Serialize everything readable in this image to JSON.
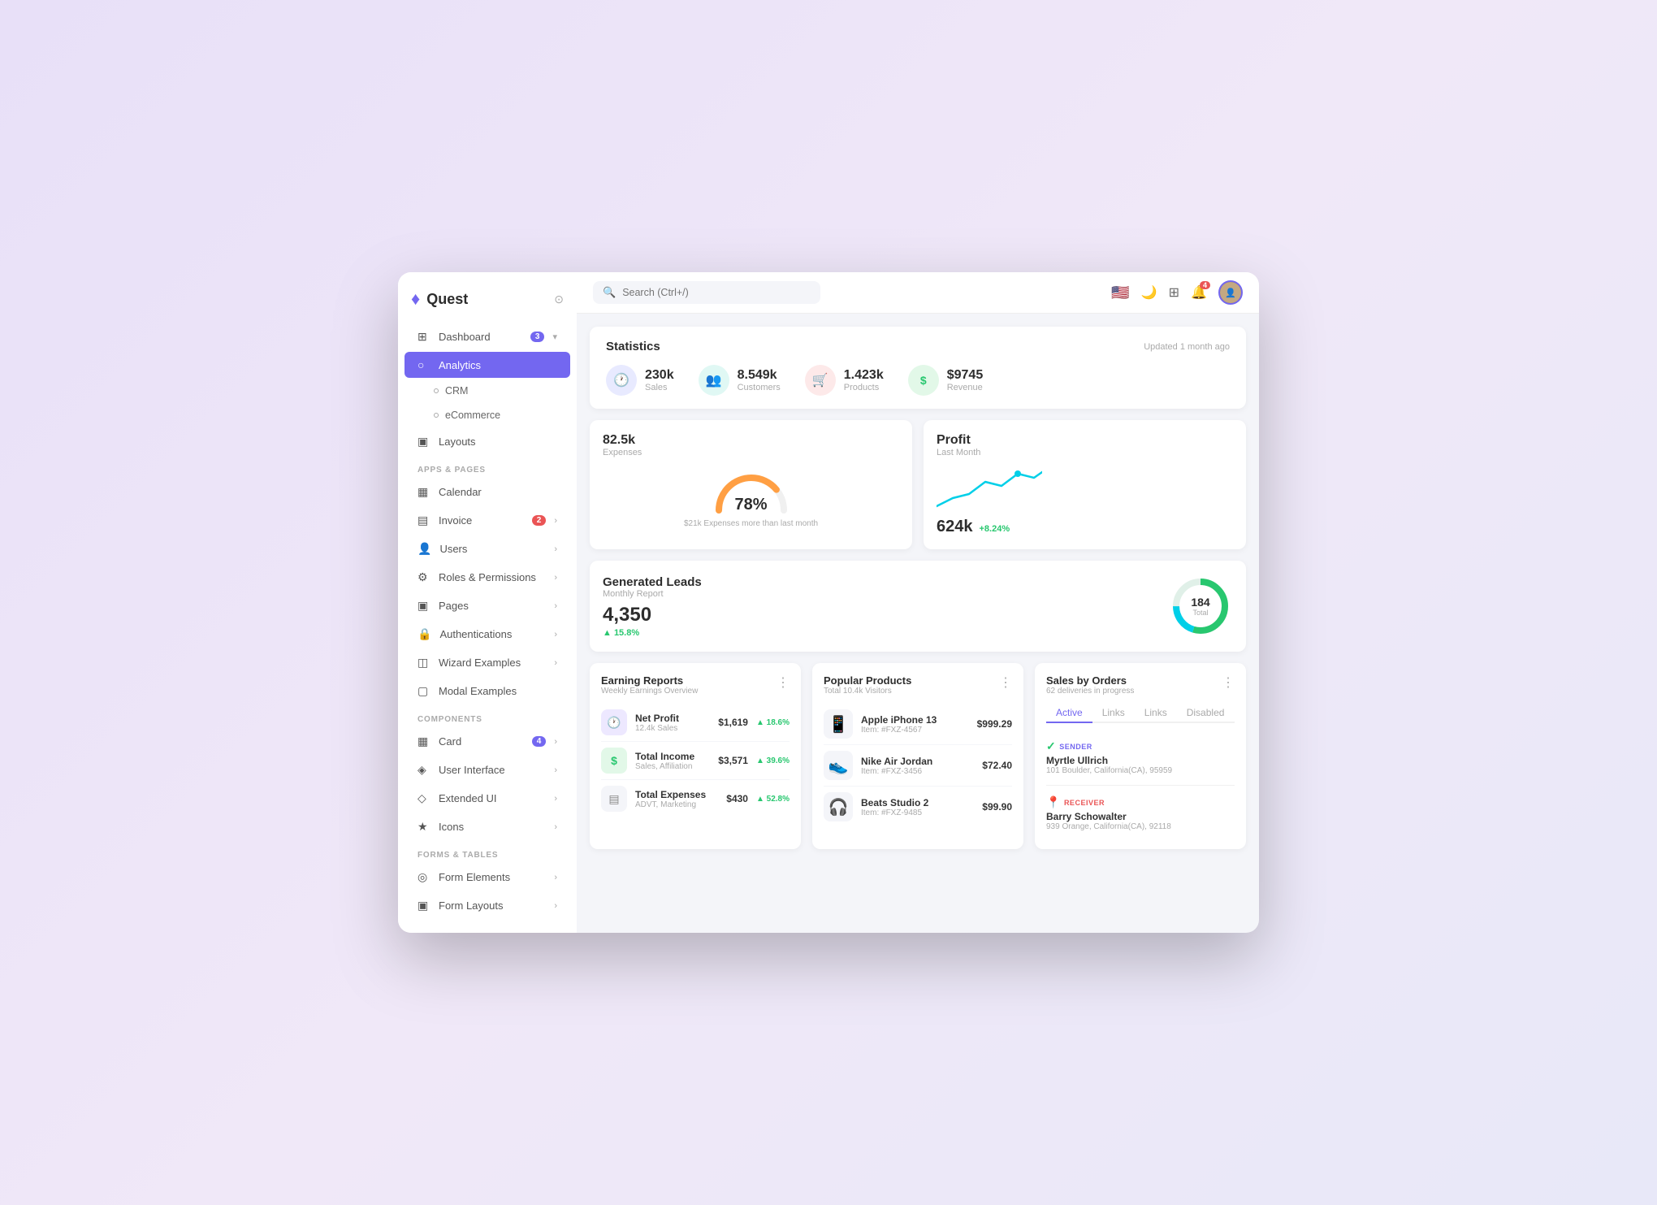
{
  "app": {
    "name": "Quest",
    "logo": "♦"
  },
  "sidebar": {
    "sections": [
      {
        "label": null,
        "items": [
          {
            "id": "dashboard",
            "label": "Dashboard",
            "icon": "⊞",
            "badge": "3",
            "chevron": "▾",
            "active": false,
            "sub": false
          },
          {
            "id": "analytics",
            "label": "Analytics",
            "icon": "○",
            "active": true,
            "sub": true,
            "indent": true
          },
          {
            "id": "crm",
            "label": "CRM",
            "icon": "○",
            "active": false,
            "sub": true,
            "indent": true
          },
          {
            "id": "ecommerce",
            "label": "eCommerce",
            "icon": "○",
            "active": false,
            "sub": true,
            "indent": true
          },
          {
            "id": "layouts",
            "label": "Layouts",
            "icon": "▣",
            "active": false,
            "sub": false
          }
        ]
      },
      {
        "label": "APPS & PAGES",
        "items": [
          {
            "id": "calendar",
            "label": "Calendar",
            "icon": "▦",
            "active": false
          },
          {
            "id": "invoice",
            "label": "Invoice",
            "icon": "▤",
            "badge_red": "2",
            "chevron": "›"
          },
          {
            "id": "users",
            "label": "Users",
            "icon": "👤",
            "chevron": "›"
          },
          {
            "id": "roles",
            "label": "Roles & Permissions",
            "icon": "⚙",
            "chevron": "›"
          },
          {
            "id": "pages",
            "label": "Pages",
            "icon": "▣",
            "chevron": "›"
          },
          {
            "id": "auth",
            "label": "Authentications",
            "icon": "🔒",
            "chevron": "›"
          },
          {
            "id": "wizard",
            "label": "Wizard Examples",
            "icon": "◫",
            "chevron": "›"
          },
          {
            "id": "modal",
            "label": "Modal Examples",
            "icon": "▢"
          }
        ]
      },
      {
        "label": "COMPONENTS",
        "items": [
          {
            "id": "card",
            "label": "Card",
            "icon": "▦",
            "badge": "4",
            "chevron": "›"
          },
          {
            "id": "ui",
            "label": "User Interface",
            "icon": "◈",
            "chevron": "›"
          },
          {
            "id": "extended",
            "label": "Extended UI",
            "icon": "◇",
            "chevron": "›"
          },
          {
            "id": "icons",
            "label": "Icons",
            "icon": "★",
            "chevron": "›"
          }
        ]
      },
      {
        "label": "FORMS & TABLES",
        "items": [
          {
            "id": "form-elements",
            "label": "Form Elements",
            "icon": "◎",
            "chevron": "›"
          },
          {
            "id": "form-layouts",
            "label": "Form Layouts",
            "icon": "▣",
            "chevron": "›"
          }
        ]
      }
    ]
  },
  "topbar": {
    "search_placeholder": "Search (Ctrl+/)",
    "notif_count": "4"
  },
  "stats": {
    "title": "Statistics",
    "updated": "Updated 1 month ago",
    "items": [
      {
        "id": "sales",
        "value": "230k",
        "label": "Sales",
        "icon": "🕐",
        "color": "blue"
      },
      {
        "id": "customers",
        "value": "8.549k",
        "label": "Customers",
        "icon": "👥",
        "color": "teal"
      },
      {
        "id": "products",
        "value": "1.423k",
        "label": "Products",
        "icon": "🛒",
        "color": "red"
      },
      {
        "id": "revenue",
        "value": "$9745",
        "label": "Revenue",
        "icon": "$",
        "color": "green"
      }
    ]
  },
  "expenses_card": {
    "title": "82.5k",
    "subtitle": "Expenses",
    "percent": "78%",
    "note": "$21k Expenses more than last month",
    "gauge_value": 78
  },
  "profit_card": {
    "title": "Profit",
    "subtitle": "Last Month",
    "value": "624k",
    "change": "+8.24%"
  },
  "leads_card": {
    "title": "Generated Leads",
    "subtitle": "Monthly Report",
    "value": "4,350",
    "change": "▲ 15.8%",
    "donut_total": "184",
    "donut_label": "Total"
  },
  "earning_reports": {
    "title": "Earning Reports",
    "subtitle": "Weekly Earnings Overview",
    "items": [
      {
        "name": "Net Profit",
        "desc": "12.4k Sales",
        "amount": "$1,619",
        "change": "▲ 18.6%",
        "icon": "🕐",
        "color": "purple"
      },
      {
        "name": "Total Income",
        "desc": "Sales, Affiliation",
        "amount": "$3,571",
        "change": "▲ 39.6%",
        "icon": "$",
        "color": "green"
      },
      {
        "name": "Total Expenses",
        "desc": "ADVT, Marketing",
        "amount": "$430",
        "change": "▲ 52.8%",
        "icon": "▤",
        "color": "gray"
      }
    ]
  },
  "popular_products": {
    "title": "Popular Products",
    "subtitle": "Total 10.4k Visitors",
    "items": [
      {
        "name": "Apple iPhone 13",
        "sku": "Item: #FXZ-4567",
        "price": "$999.29",
        "emoji": "📱"
      },
      {
        "name": "Nike Air Jordan",
        "sku": "Item: #FXZ-3456",
        "price": "$72.40",
        "emoji": "👟"
      },
      {
        "name": "Beats Studio 2",
        "sku": "Item: #FXZ-9485",
        "price": "$99.90",
        "emoji": "🎧"
      }
    ]
  },
  "sales_orders": {
    "title": "Sales by Orders",
    "subtitle": "62 deliveries in progress",
    "tabs": [
      "Active",
      "Links",
      "Links",
      "Disabled"
    ],
    "active_tab": 0,
    "sender": {
      "label": "SENDER",
      "name": "Myrtle Ullrich",
      "address": "101 Boulder, California(CA), 95959"
    },
    "receiver": {
      "label": "RECEIVER",
      "name": "Barry Schowalter",
      "address": "939 Orange, California(CA), 92118"
    }
  }
}
